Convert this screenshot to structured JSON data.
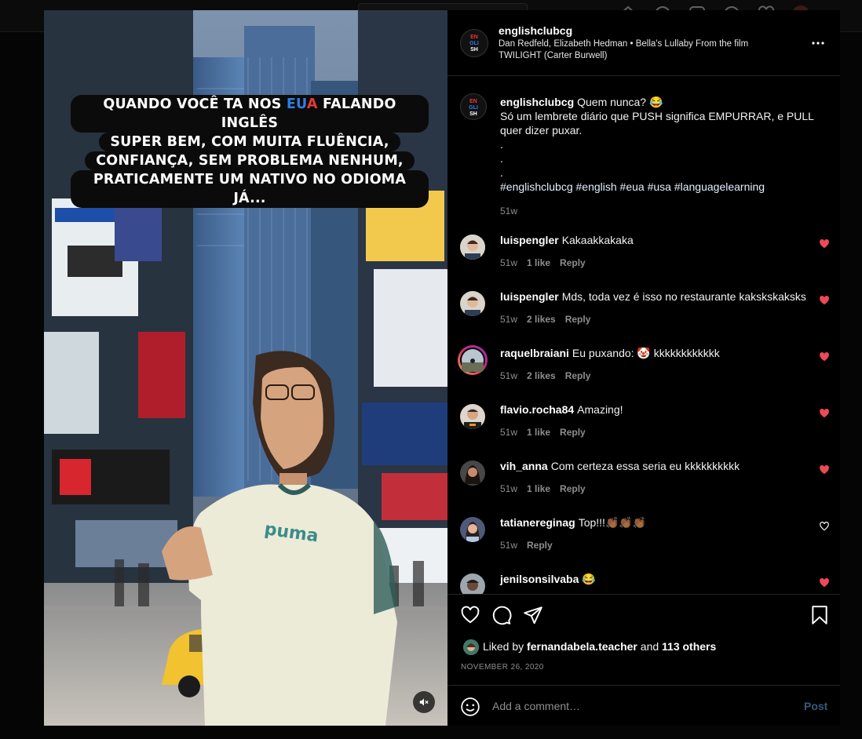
{
  "post": {
    "username": "englishclubcg",
    "music": "Dan Redfeld, Elizabeth Hedman • Bella's Lullaby From the film TWILIGHT (Carter Burwell)",
    "logo_lines": [
      "EN",
      "GLI",
      "SH"
    ]
  },
  "media": {
    "caption_lines": [
      {
        "before": "QUANDO VOCÊ TA NOS ",
        "e": "E",
        "u": "U",
        "a": "A",
        "after": " FALANDO INGLÊS"
      },
      "SUPER BEM, COM MUITA FLUÊNCIA,",
      "CONFIANÇA, SEM PROBLEMA NENHUM,",
      "PRATICAMENTE UM NATIVO NO ODIOMA JÁ..."
    ],
    "shirt_text": "puma"
  },
  "caption": {
    "username": "englishclubcg",
    "first_line": "Quem nunca? 😂",
    "body": "Só um lembrete diário que PUSH significa EMPURRAR, e PULL quer dizer puxar.",
    "dots": [
      ".",
      ".",
      "."
    ],
    "hashtags": "#englishclubcg #english #eua #usa #languagelearning",
    "time": "51w"
  },
  "comments": [
    {
      "username": "luispengler",
      "text": "Kakaakkakaka",
      "time": "51w",
      "likes": "1 like",
      "reply": "Reply",
      "liked": true
    },
    {
      "username": "luispengler",
      "text": "Mds, toda vez é isso no restaurante kakskskaksks",
      "time": "51w",
      "likes": "2 likes",
      "reply": "Reply",
      "liked": true
    },
    {
      "username": "raquelbraiani",
      "text": "Eu puxando: 🤡 kkkkkkkkkkkk",
      "time": "51w",
      "likes": "2 likes",
      "reply": "Reply",
      "liked": true
    },
    {
      "username": "flavio.rocha84",
      "text": "Amazing!",
      "time": "51w",
      "likes": "1 like",
      "reply": "Reply",
      "liked": true
    },
    {
      "username": "vih_anna",
      "text": "Com certeza essa seria eu kkkkkkkkkk",
      "time": "51w",
      "likes": "1 like",
      "reply": "Reply",
      "liked": true
    },
    {
      "username": "tatianereginag",
      "text": "Top!!!👏🏾👏🏾👏🏾",
      "time": "51w",
      "likes": "",
      "reply": "Reply",
      "liked": false
    },
    {
      "username": "jenilsonsilvaba",
      "text": "😂",
      "time": "",
      "likes": "",
      "reply": "",
      "liked": true
    }
  ],
  "likes": {
    "prefix": "Liked by",
    "user": "fernandabela.teacher",
    "mid": "and",
    "others": "113 others"
  },
  "date": "NOVEMBER 26, 2020",
  "add_comment": {
    "placeholder": "Add a comment…",
    "post_label": "Post"
  },
  "colors": {
    "heart_liked": "#ed4956",
    "hashtag": "#e0f1ff",
    "muted": "#8e8e8e"
  }
}
